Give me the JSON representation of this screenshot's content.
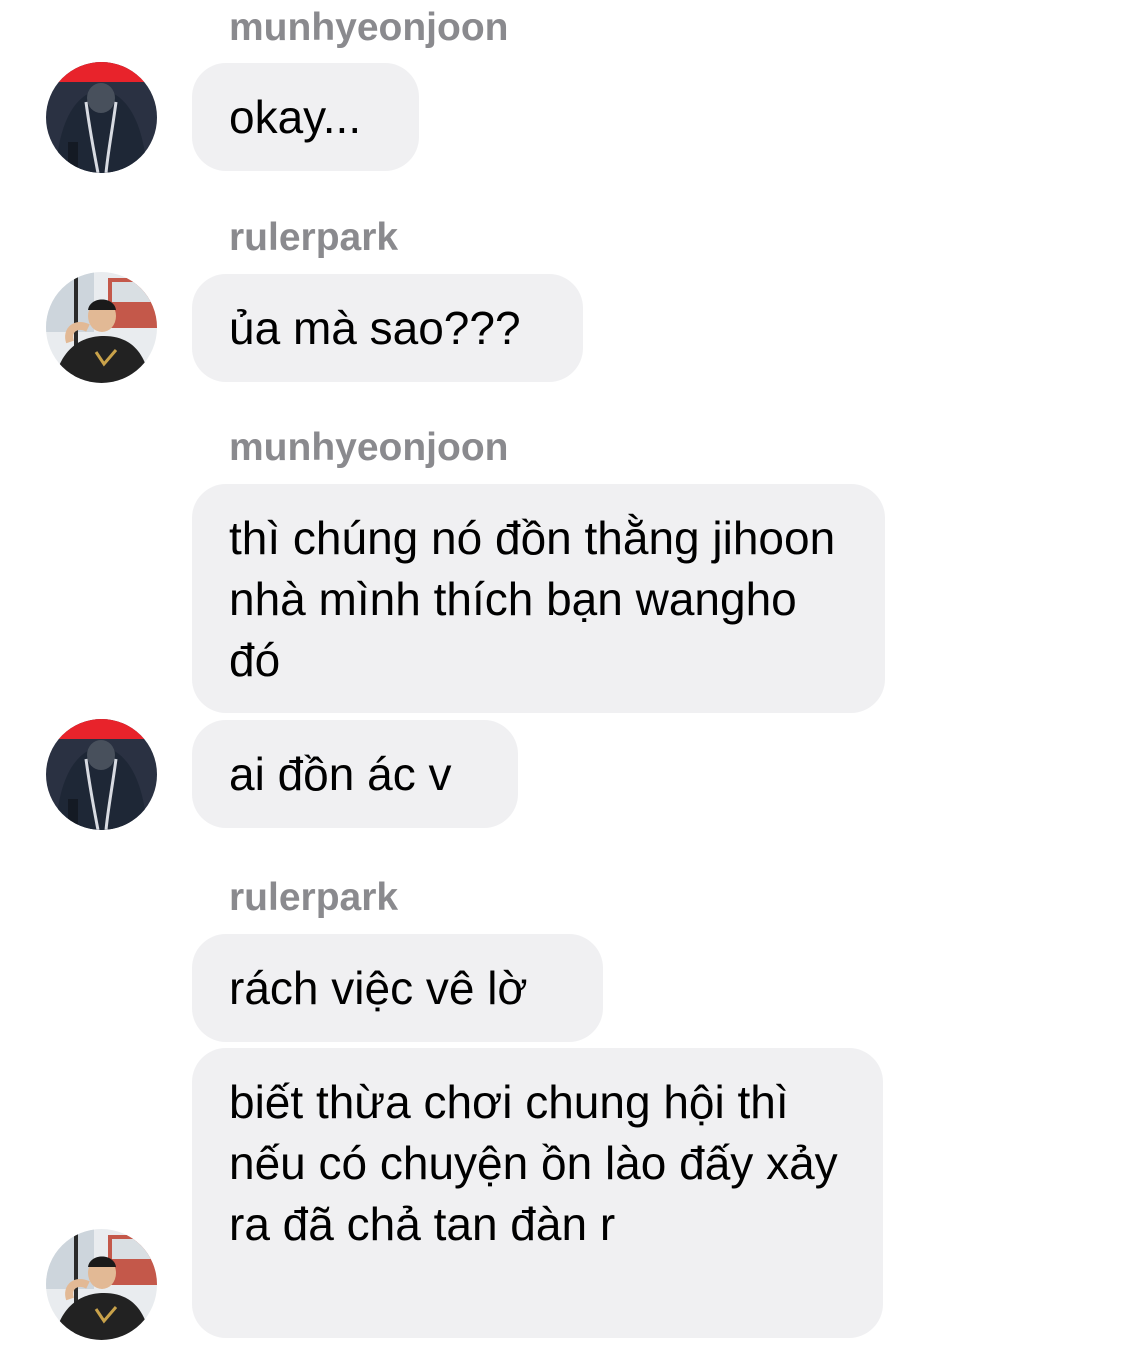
{
  "chat": {
    "messages": [
      {
        "sender": "munhyeonjoon",
        "text": "okay..."
      },
      {
        "sender": "rulerpark",
        "text": "ủa mà sao???"
      },
      {
        "sender": "munhyeonjoon",
        "text": "thì chúng nó đồn thằng jihoon nhà mình thích bạn wangho đó"
      },
      {
        "sender": "munhyeonjoon",
        "text": "ai đồn ác v"
      },
      {
        "sender": "rulerpark",
        "text": "rách việc vê lờ"
      },
      {
        "sender": "rulerpark",
        "text": "biết thừa chơi chung hội thì nếu có chuyện ồn lào đấy xảy ra đã chả tan đàn r"
      }
    ],
    "avatars": {
      "munhyeonjoon": {
        "icon": "hooded-person-avatar",
        "accent": "#e8232b",
        "base": "#1f2a3a"
      },
      "rulerpark": {
        "icon": "person-window-avatar",
        "accent": "#c4584a",
        "base": "#2a2a2a"
      }
    }
  }
}
